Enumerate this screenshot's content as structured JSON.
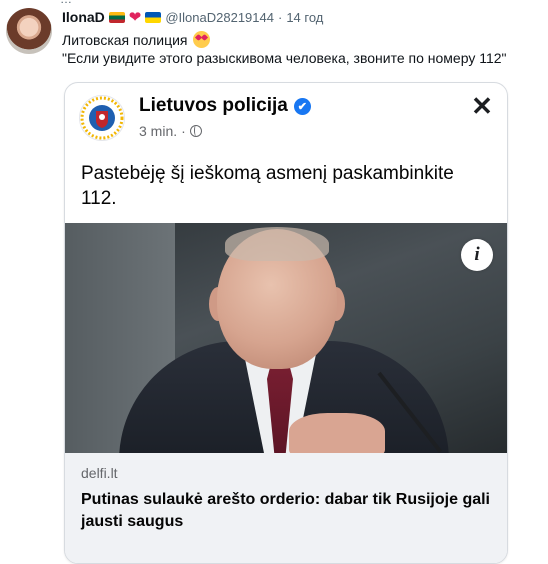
{
  "tweet": {
    "author_name": "IlonaD",
    "handle": "@IlonaD28219144",
    "separator": "·",
    "time": "14 год",
    "text_line1": "Литовская полиция",
    "text_line2": "\"Если увидите этого разыскивома человека, звоните по номеру 112\""
  },
  "post": {
    "page_name": "Lietuvos policija",
    "verified": "✔",
    "time": "3 min.",
    "separator": "·",
    "close": "✕",
    "text": "Pastebėję šį ieškomą asmenį paskambinkite 112.",
    "info": "i",
    "link_domain": "delfi.lt",
    "link_title": "Putinas sulaukė arešto orderio: dabar tik Rusijoje gali jausti saugus"
  },
  "colors": {
    "verified_blue": "#1877f2",
    "link_bg": "#f0f2f5",
    "muted_text": "#65676b"
  },
  "icons": [
    "avatar",
    "lithuania-flag-icon",
    "heart-icon",
    "ukraine-flag-icon",
    "heart-eyes-emoji-icon",
    "police-logo-icon",
    "verified-icon",
    "globe-icon",
    "close-icon",
    "info-icon"
  ]
}
